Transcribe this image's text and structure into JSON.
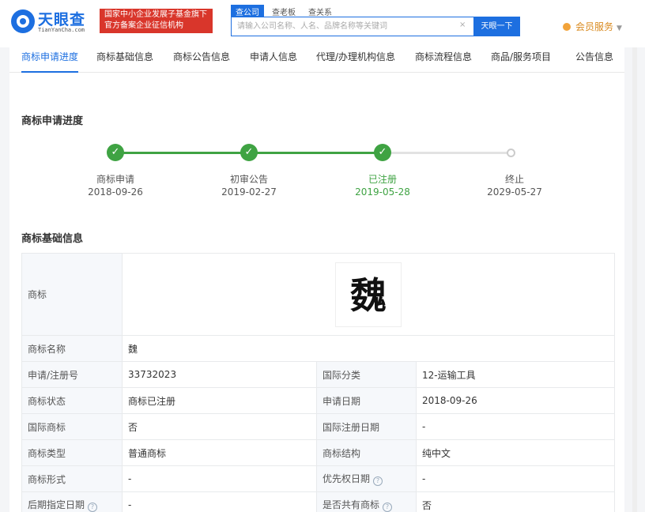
{
  "brand": {
    "name": "天眼查",
    "domain": "TianYanCha.com",
    "badge_line1": "国家中小企业发展子基金旗下",
    "badge_line2": "官方备案企业征信机构"
  },
  "search": {
    "tabs": [
      "查公司",
      "查老板",
      "查关系"
    ],
    "placeholder": "请输入公司名称、人名、品牌名称等关键词",
    "clear_icon": "×",
    "button_label": "天眼一下"
  },
  "vip": {
    "label": "会员服务",
    "caret": "▼"
  },
  "nav": {
    "items": [
      "商标申请进度",
      "商标基础信息",
      "商标公告信息",
      "申请人信息",
      "代理/办理机构信息",
      "商标流程信息",
      "商品/服务项目",
      "公告信息"
    ]
  },
  "progress": {
    "title": "商标申请进度",
    "steps": [
      {
        "label": "商标申请",
        "date": "2018-09-26",
        "status": "done"
      },
      {
        "label": "初审公告",
        "date": "2019-02-27",
        "status": "done"
      },
      {
        "label": "已注册",
        "date": "2019-05-28",
        "status": "current"
      },
      {
        "label": "终止",
        "date": "2029-05-27",
        "status": "pending"
      }
    ],
    "check_glyph": "✓",
    "colors": {
      "done": "#3fa343",
      "pending": "#cccccc"
    }
  },
  "basic_info": {
    "title": "商标基础信息",
    "trademark_label": "商标",
    "trademark_image_text": "魏",
    "name_label": "商标名称",
    "name_value": "魏",
    "rows": [
      {
        "l1": "申请/注册号",
        "v1": "33732023",
        "l2": "国际分类",
        "v2": "12-运输工具"
      },
      {
        "l1": "商标状态",
        "v1": "商标已注册",
        "l2": "申请日期",
        "v2": "2018-09-26"
      },
      {
        "l1": "国际商标",
        "v1": "否",
        "l2": "国际注册日期",
        "v2": "-"
      },
      {
        "l1": "商标类型",
        "v1": "普通商标",
        "l2": "商标结构",
        "v2": "纯中文"
      },
      {
        "l1": "商标形式",
        "v1": "-",
        "l2": "优先权日期",
        "v2": "-"
      },
      {
        "l1": "后期指定日期",
        "v1": "-",
        "l2": "是否共有商标",
        "v2": "否"
      }
    ],
    "help_glyph": "?"
  }
}
